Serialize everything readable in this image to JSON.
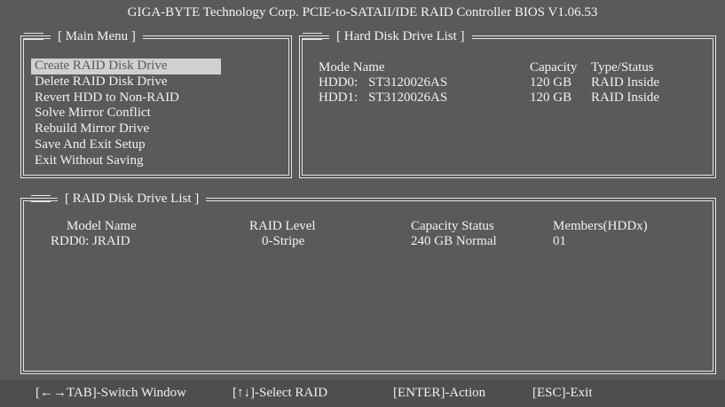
{
  "title": "GIGA-BYTE Technology Corp. PCIE-to-SATAII/IDE RAID Controller BIOS V1.06.53",
  "main_menu": {
    "heading": "[ Main Menu ]",
    "items": [
      {
        "label": "Create RAID Disk Drive",
        "selected": true
      },
      {
        "label": "Delete RAID Disk Drive",
        "selected": false
      },
      {
        "label": "Revert HDD to Non-RAID",
        "selected": false
      },
      {
        "label": "Solve Mirror Conflict",
        "selected": false
      },
      {
        "label": "Rebuild Mirror Drive",
        "selected": false
      },
      {
        "label": "Save And Exit Setup",
        "selected": false
      },
      {
        "label": "Exit Without Saving",
        "selected": false
      }
    ]
  },
  "hdd_list": {
    "heading": "[ Hard Disk Drive List ]",
    "columns": [
      "Mode Name",
      "Capacity",
      "Type/Status"
    ],
    "rows": [
      {
        "id": "HDD0:",
        "name": "ST3120026AS",
        "capacity": "120 GB",
        "status": "RAID Inside"
      },
      {
        "id": "HDD1:",
        "name": "ST3120026AS",
        "capacity": "120 GB",
        "status": "RAID Inside"
      }
    ]
  },
  "raid_list": {
    "heading": "[ RAID Disk Drive List ]",
    "columns": [
      "Model Name",
      "RAID Level",
      "Capacity Status",
      "Members(HDDx)"
    ],
    "rows": [
      {
        "name": "RDD0: JRAID",
        "level": "0-Stripe",
        "capacity_status": "240 GB Normal",
        "members": "01"
      }
    ]
  },
  "footer": {
    "switch_window": "[←→TAB]-Switch Window",
    "select_raid": "[↑↓]-Select RAID",
    "action": "[ENTER]-Action",
    "exit": "[ESC]-Exit"
  }
}
